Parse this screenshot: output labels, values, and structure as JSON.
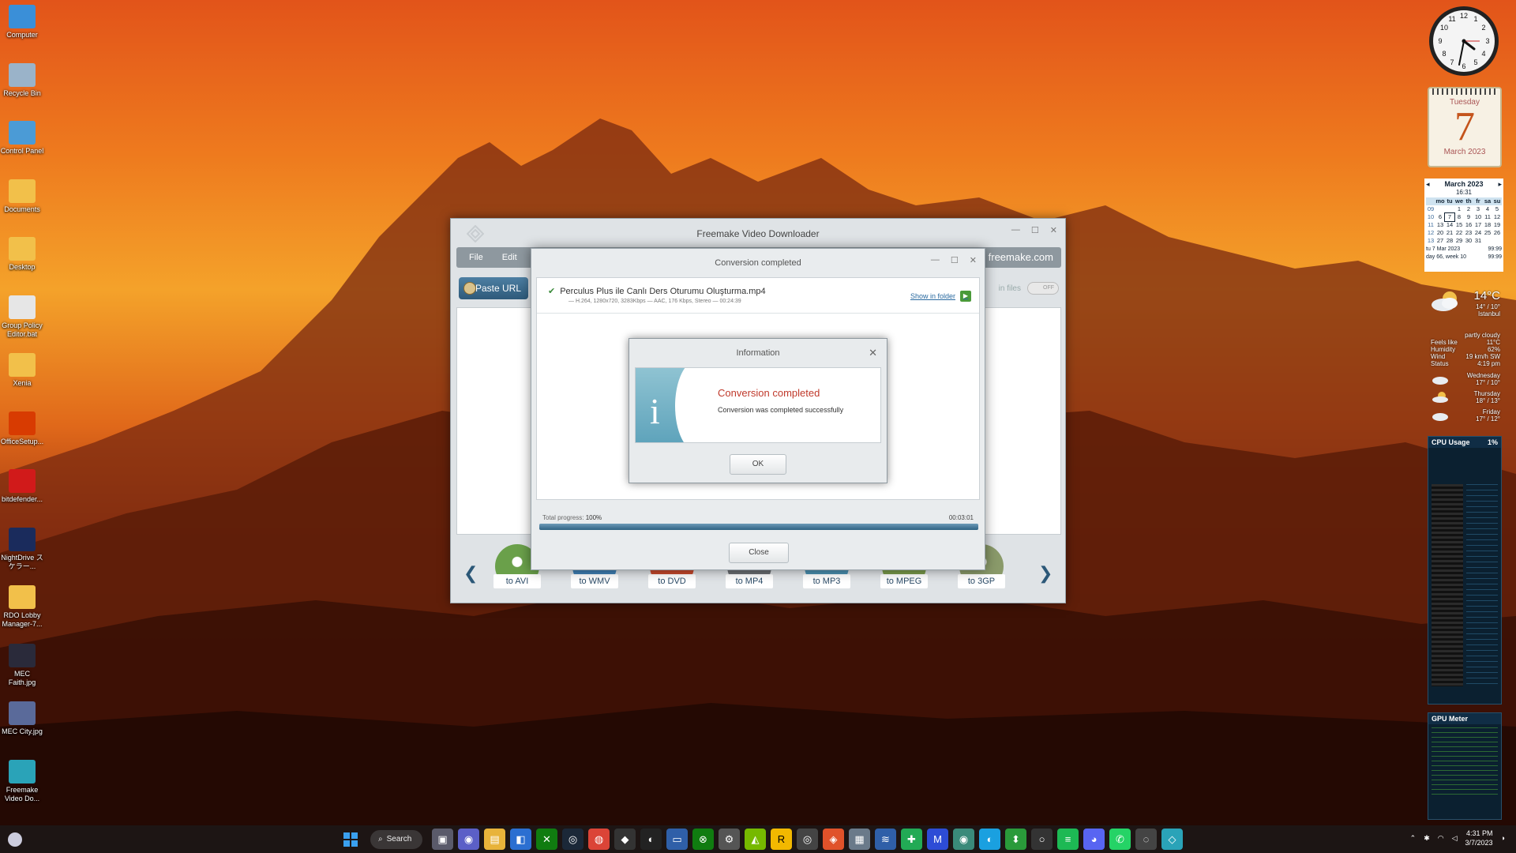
{
  "desktop": {
    "icons": [
      {
        "label": "Computer",
        "icon": "monitor-icon",
        "color": "#3a8fd8"
      },
      {
        "label": "Recycle Bin",
        "icon": "recycle-bin-icon",
        "color": "#9ab3c9"
      },
      {
        "label": "Control Panel",
        "icon": "control-panel-icon",
        "color": "#4b9bd6"
      },
      {
        "label": "Documents",
        "icon": "folder-icon",
        "color": "#f2c04a"
      },
      {
        "label": "Desktop",
        "icon": "folder-icon",
        "color": "#f2c04a"
      },
      {
        "label": "Group Policy Editor.bat",
        "icon": "gear-file-icon",
        "color": "#e6e6e6"
      },
      {
        "label": "Xenia",
        "icon": "folder-icon",
        "color": "#f2c04a"
      },
      {
        "label": "OfficeSetup...",
        "icon": "office-icon",
        "color": "#d83b01"
      },
      {
        "label": "bitdefender...",
        "icon": "bitdefender-icon",
        "color": "#d11a1a"
      },
      {
        "label": "NightDrive スケラー...",
        "icon": "image-icon",
        "color": "#1a2b5c"
      },
      {
        "label": "RDO Lobby Manager-7...",
        "icon": "folder-icon",
        "color": "#f2c04a"
      },
      {
        "label": "MEC Faith.jpg",
        "icon": "image-icon",
        "color": "#2a2a3a"
      },
      {
        "label": "MEC City.jpg",
        "icon": "image-icon",
        "color": "#5a6a9a"
      },
      {
        "label": "Freemake Video Do...",
        "icon": "freemake-icon",
        "color": "#2aa3b8"
      }
    ]
  },
  "gadgets": {
    "calendar": {
      "weekday": "Tuesday",
      "day": "7",
      "month_year": "March 2023"
    },
    "mini_calendar": {
      "title": "March 2023",
      "time": "16:31",
      "headers": [
        "",
        "mo",
        "tu",
        "we",
        "th",
        "fr",
        "sa",
        "su"
      ],
      "rows": [
        [
          "09",
          "",
          "",
          "1",
          "2",
          "3",
          "4",
          "5"
        ],
        [
          "10",
          "6",
          "7",
          "8",
          "9",
          "10",
          "11",
          "12"
        ],
        [
          "11",
          "13",
          "14",
          "15",
          "16",
          "17",
          "18",
          "19"
        ],
        [
          "12",
          "20",
          "21",
          "22",
          "23",
          "24",
          "25",
          "26"
        ],
        [
          "13",
          "27",
          "28",
          "29",
          "30",
          "31",
          "",
          ""
        ]
      ],
      "footer1": "tu 7 Mar 2023",
      "footer1_right": "99:99",
      "footer2": "day 66, week 10",
      "footer2_right": "99:99"
    },
    "weather": {
      "temp": "14°C",
      "range": "14° / 10°",
      "city": "Istanbul",
      "condition": "partly cloudy",
      "rows": [
        {
          "k": "Feels like",
          "v": "11°C"
        },
        {
          "k": "Humidity",
          "v": "62%"
        },
        {
          "k": "Wind",
          "v": "19 km/h SW"
        },
        {
          "k": "Status",
          "v": "4:19 pm"
        }
      ],
      "forecast": [
        {
          "day": "Wednesday",
          "range": "17° / 10°"
        },
        {
          "day": "Thursday",
          "range": "18° / 13°"
        },
        {
          "day": "Friday",
          "range": "17° / 12°"
        }
      ]
    },
    "cpu": {
      "title": "CPU Usage",
      "value": "1%"
    },
    "gpu": {
      "title": "GPU Meter"
    }
  },
  "app": {
    "title": "Freemake Video Downloader",
    "menu": {
      "file": "File",
      "edit": "Edit",
      "brand": "freemake.com"
    },
    "paste_url": "Paste URL",
    "toggle_label": "in files",
    "toggle_state": "OFF",
    "formats": [
      {
        "label": "to AVI",
        "color": "#6aa04a"
      },
      {
        "label": "to WMV",
        "color": "#3f7fb4"
      },
      {
        "label": "to DVD",
        "color": "#c7482c"
      },
      {
        "label": "to MP4",
        "color": "#6b6e72"
      },
      {
        "label": "to MP3",
        "color": "#4a8fb0"
      },
      {
        "label": "to MPEG",
        "color": "#7a9a4a"
      },
      {
        "label": "to 3GP",
        "color": "#8a9a6a"
      }
    ]
  },
  "conversion_dialog": {
    "title": "Conversion completed",
    "file_name": "Perculus Plus ile Canlı Ders Oturumu Oluşturma.mp4",
    "file_meta": "— H.264, 1280x720, 3283Kbps — AAC, 176 Kbps, Stereo — 00:24:39",
    "show_in_folder": "Show in folder",
    "progress_label": "Total progress:",
    "progress_value": "100%",
    "progress_fraction": 1.0,
    "elapsed": "00:03:01",
    "close": "Close"
  },
  "info_dialog": {
    "title": "Information",
    "heading": "Conversion completed",
    "message": "Conversion was completed successfully",
    "ok": "OK"
  },
  "taskbar": {
    "search": "Search",
    "time": "4:31 PM",
    "date": "3/7/2023"
  }
}
